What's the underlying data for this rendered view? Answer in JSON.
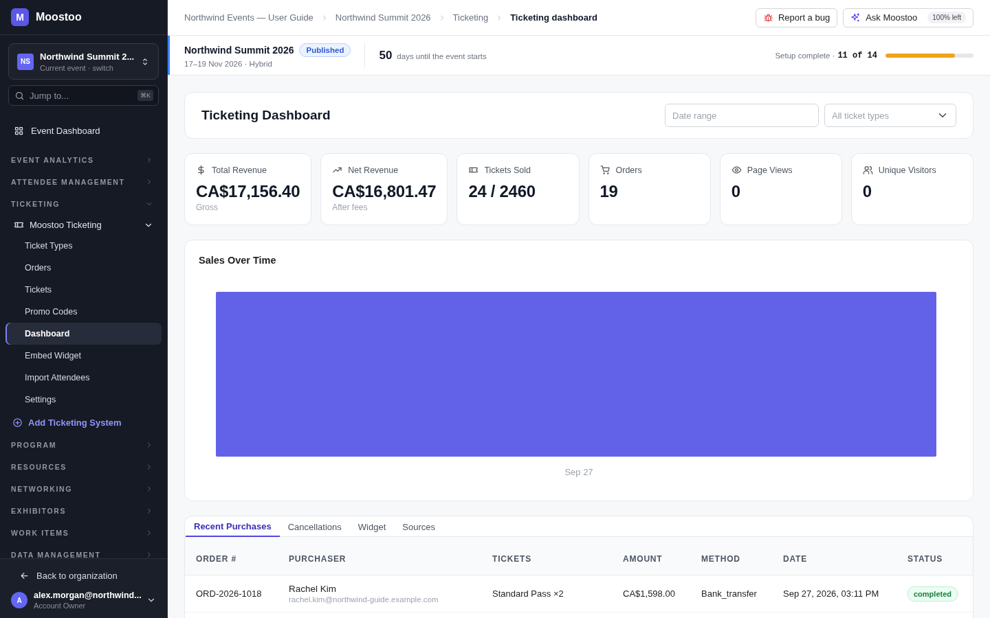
{
  "app": {
    "logo_letter": "M",
    "name": "Moostoo"
  },
  "event_switcher": {
    "initials": "NS",
    "name": "Northwind Summit 2...",
    "subtitle": "Current event · switch"
  },
  "jump": {
    "placeholder": "Jump to...",
    "shortcut": "⌘K"
  },
  "sidebar": {
    "items": [
      {
        "kind": "link",
        "label": "Event Dashboard"
      },
      {
        "kind": "section",
        "label": "EVENT ANALYTICS",
        "expanded": false
      },
      {
        "kind": "section",
        "label": "ATTENDEE MANAGEMENT",
        "expanded": false
      },
      {
        "kind": "section",
        "label": "TICKETING",
        "expanded": true,
        "children": [
          {
            "kind": "group",
            "label": "Moostoo Ticketing",
            "expanded": true,
            "children": [
              {
                "label": "Ticket Types",
                "selected": false
              },
              {
                "label": "Orders",
                "selected": false
              },
              {
                "label": "Tickets",
                "selected": false
              },
              {
                "label": "Promo Codes",
                "selected": false
              },
              {
                "label": "Dashboard",
                "selected": true
              },
              {
                "label": "Embed Widget",
                "selected": false
              },
              {
                "label": "Import Attendees",
                "selected": false
              },
              {
                "label": "Settings",
                "selected": false
              }
            ]
          },
          {
            "kind": "add",
            "label": "Add Ticketing System"
          }
        ]
      },
      {
        "kind": "section",
        "label": "PROGRAM",
        "expanded": false
      },
      {
        "kind": "section",
        "label": "RESOURCES",
        "expanded": false
      },
      {
        "kind": "section",
        "label": "NETWORKING",
        "expanded": false
      },
      {
        "kind": "section",
        "label": "EXHIBITORS",
        "expanded": false
      },
      {
        "kind": "section",
        "label": "WORK ITEMS",
        "expanded": false
      },
      {
        "kind": "section",
        "label": "DATA MANAGEMENT",
        "expanded": false
      }
    ]
  },
  "back_link": "Back to organization",
  "account": {
    "initial": "A",
    "email": "alex.morgan@northwind...",
    "role": "Account Owner"
  },
  "breadcrumbs": [
    "Northwind Events — User Guide",
    "Northwind Summit 2026",
    "Ticketing",
    "Ticketing dashboard"
  ],
  "top_buttons": {
    "report": "Report a bug",
    "ask": "Ask Moostoo",
    "ask_badge": "100% left"
  },
  "event": {
    "name": "Northwind Summit 2026",
    "status": "Published",
    "dates": "17–19 Nov 2026 · Hybrid",
    "countdown": "50",
    "countdown_text": "days until the event starts",
    "setup_label": "Setup complete ·",
    "setup_count": "11 of 14",
    "setup": {
      "level": 0.786
    }
  },
  "page": {
    "title": "Ticketing Dashboard",
    "date_placeholder": "Date range",
    "ticket_filter": "All ticket types"
  },
  "kpis": [
    {
      "kind": "dollar",
      "label": "Total Revenue",
      "value": "CA$17,156.40",
      "note": "Gross"
    },
    {
      "kind": "trend",
      "label": "Net Revenue",
      "value": "CA$16,801.47",
      "note": "After fees"
    },
    {
      "kind": "ticket",
      "label": "Tickets Sold",
      "value": "24 / 2460"
    },
    {
      "kind": "cart",
      "label": "Orders",
      "value": "19"
    },
    {
      "kind": "eye",
      "label": "Page Views",
      "value": "0"
    },
    {
      "kind": "users",
      "label": "Unique Visitors",
      "value": "0"
    }
  ],
  "sales_chart": {
    "title": "Sales Over Time",
    "x_label": "Sep 27"
  },
  "tabs": [
    {
      "label": "Recent Purchases",
      "selected": true
    },
    {
      "label": "Cancellations",
      "selected": false
    },
    {
      "label": "Widget",
      "selected": false
    },
    {
      "label": "Sources",
      "selected": false
    }
  ],
  "table": {
    "columns": [
      "ORDER #",
      "PURCHASER",
      "TICKETS",
      "AMOUNT",
      "METHOD",
      "DATE",
      "STATUS"
    ],
    "rows": [
      {
        "order": "ORD-2026-1018",
        "name": "Rachel Kim",
        "email": "rachel.kim@northwind-guide.example.com",
        "tickets": "Standard Pass ×2",
        "amount": "CA$1,598.00",
        "method": "Bank_transfer",
        "date": "Sep 27, 2026, 03:11 PM",
        "status": "completed",
        "kind": "success"
      }
    ]
  }
}
